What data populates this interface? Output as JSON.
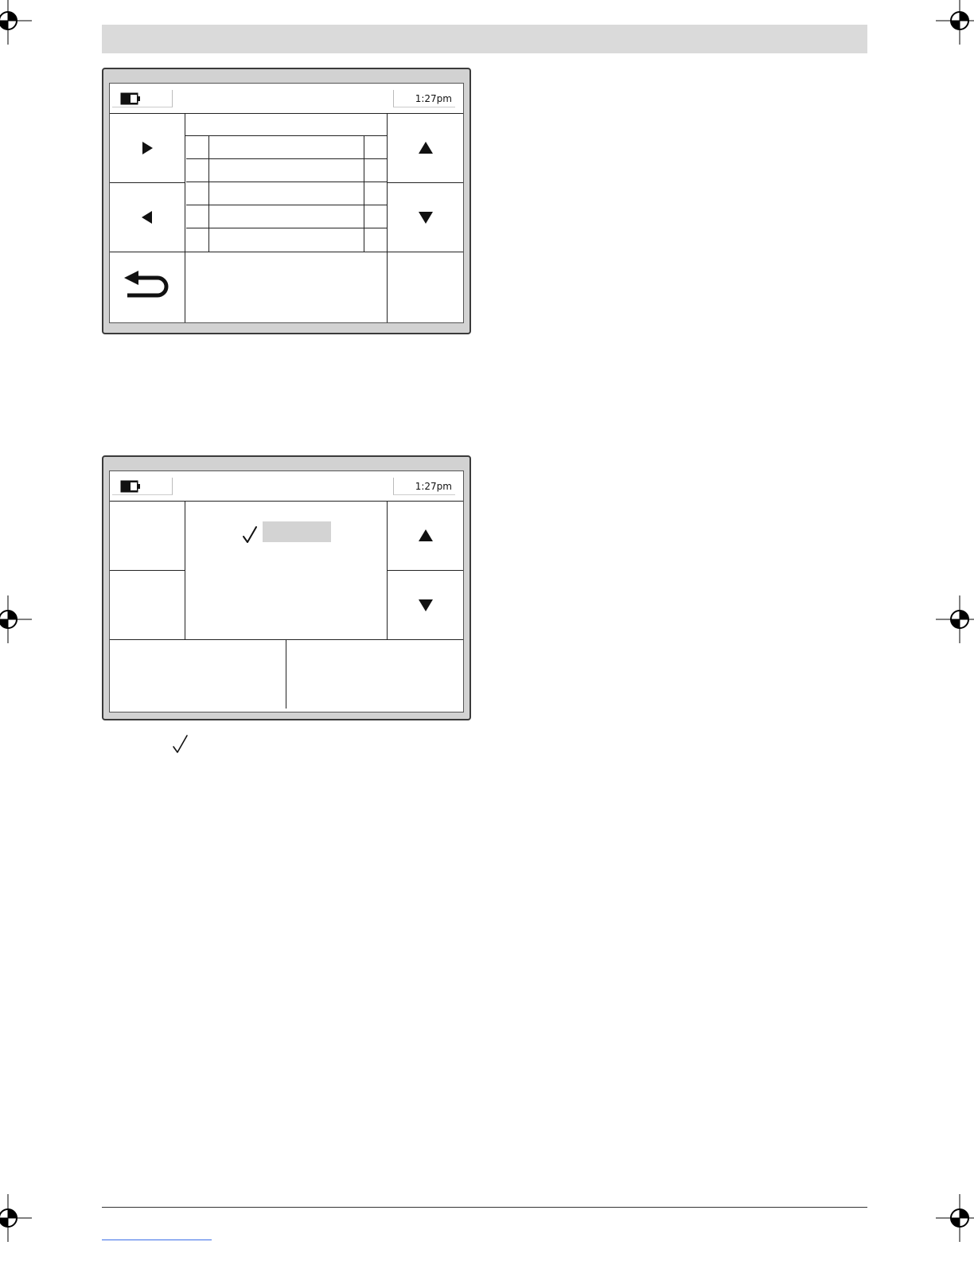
{
  "figure_1": {
    "status_time": "1:27pm",
    "battery_icon": "battery-icon",
    "softkeys": {
      "left_top": "play-right-icon",
      "left_middle": "play-left-icon",
      "left_bottom": "return-arrow-icon",
      "right_top": "arrow-up-icon",
      "right_middle": "arrow-down-icon"
    },
    "list_rows": 5
  },
  "figure_2": {
    "status_time": "1:27pm",
    "battery_icon": "battery-icon",
    "selection_icon": "checkmark-icon",
    "softkeys": {
      "right_top": "arrow-up-icon",
      "right_middle": "arrow-down-icon"
    }
  },
  "below_figure_icon": "checkmark-icon",
  "colors": {
    "header_band": "#dadada",
    "device_bezel": "#d2d2d2",
    "highlight": "#d3d3d3",
    "link_line": "#3a6ee8"
  }
}
